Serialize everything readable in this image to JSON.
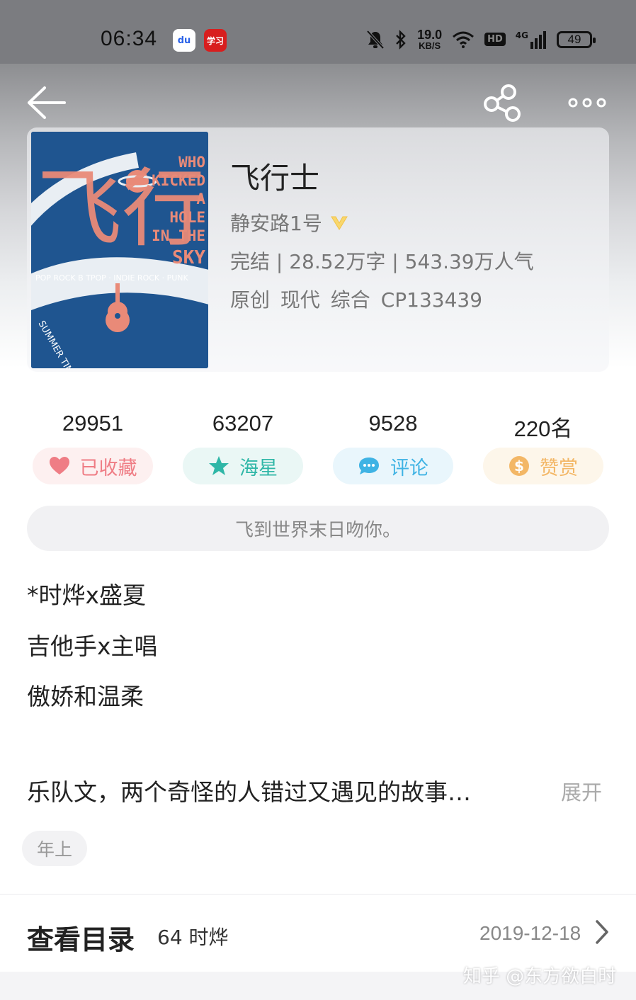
{
  "status_bar": {
    "time": "06:34",
    "baidu_icon_text": "du",
    "xuexi_icon_text": "学习",
    "speed_value": "19.0",
    "speed_unit": "KB/S",
    "hd_label": "HD",
    "network_label": "4G",
    "battery_level": "49",
    "icons": [
      "bell-off-icon",
      "bluetooth-icon",
      "wifi-icon",
      "signal-icon",
      "battery-icon"
    ]
  },
  "nav": {
    "icons": [
      "back-arrow-icon",
      "share-icon",
      "more-icon"
    ]
  },
  "book": {
    "title": "飞行士",
    "author": "静安路1号",
    "meta": "完结 | 28.52万字 | 543.39万人气",
    "tags": "原创 现代 综合 CP133439",
    "cover": {
      "title_glyph": "飞行士",
      "text_lines": [
        "WHO",
        "KICKED",
        "A",
        "HOLE",
        "IN THE",
        "SKY"
      ],
      "genres": "POP ROCK B   TPOP · INDIE ROCK · PUNK",
      "subtitle": "SUMMER TIME"
    }
  },
  "stats": [
    {
      "value": "29951",
      "label": "已收藏",
      "icon": "heart-icon",
      "color": "#ef7d85"
    },
    {
      "value": "63207",
      "label": "海星",
      "icon": "star-icon",
      "color": "#2fb7a7"
    },
    {
      "value": "9528",
      "label": "评论",
      "icon": "comment-icon",
      "color": "#3fb3e4"
    },
    {
      "value": "220名",
      "label": "赞赏",
      "icon": "coin-icon",
      "color": "#f3b766"
    }
  ],
  "slogan": "飞到世界末日吻你。",
  "intro": [
    "*时烨x盛夏",
    "吉他手x主唱",
    "傲娇和温柔"
  ],
  "summary": "乐队文，两个奇怪的人错过又遇见的故事…",
  "expand_label": "展开",
  "tag": "年上",
  "toc": {
    "title": "查看目录",
    "latest": "64 时烨",
    "date": "2019-12-18"
  },
  "watermark": "知乎 @东方欲白时"
}
